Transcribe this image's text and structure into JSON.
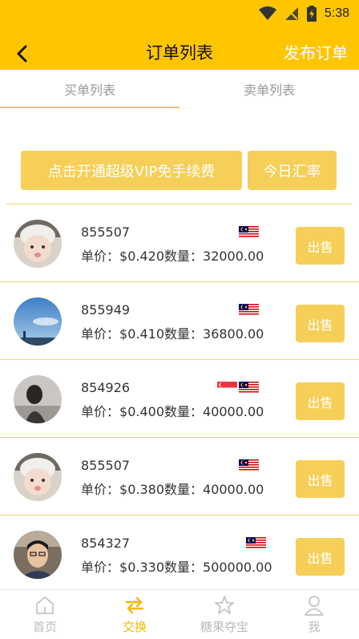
{
  "status_bar": {
    "time": "5:38"
  },
  "header": {
    "title": "订单列表",
    "action_label": "发布订单"
  },
  "tabs": [
    {
      "label": "买单列表"
    },
    {
      "label": "卖单列表"
    }
  ],
  "buttons": {
    "vip": "点击开通超级VIP免手续费",
    "rate": "今日汇率"
  },
  "orders": [
    {
      "id": "855507",
      "price_label": "单价：",
      "price": "$0.420",
      "qty_label": "数量：",
      "qty": "32000.00",
      "flags": [
        "malaysia"
      ],
      "sell_label": "出售",
      "avatar": "baby"
    },
    {
      "id": "855949",
      "price_label": "单价：",
      "price": "$0.410",
      "qty_label": "数量：",
      "qty": "36800.00",
      "flags": [
        "malaysia"
      ],
      "sell_label": "出售",
      "avatar": "sky"
    },
    {
      "id": "854926",
      "price_label": "单价：",
      "price": "$0.400",
      "qty_label": "数量：",
      "qty": "40000.00",
      "flags": [
        "singapore",
        "malaysia"
      ],
      "sell_label": "出售",
      "avatar": "woman"
    },
    {
      "id": "855507",
      "price_label": "单价：",
      "price": "$0.380",
      "qty_label": "数量：",
      "qty": "40000.00",
      "flags": [
        "malaysia"
      ],
      "sell_label": "出售",
      "avatar": "baby"
    },
    {
      "id": "854327",
      "price_label": "单价：",
      "price": "$0.330",
      "qty_label": "数量：",
      "qty": "500000.00",
      "flags": [
        "malaysia"
      ],
      "sell_label": "出售",
      "avatar": "man"
    }
  ],
  "bottom_nav": [
    {
      "label": "首页",
      "icon": "home-icon",
      "active": false
    },
    {
      "label": "交换",
      "icon": "exchange-icon",
      "active": true
    },
    {
      "label": "糖果夺宝",
      "icon": "star-icon",
      "active": false
    },
    {
      "label": "我",
      "icon": "person-icon",
      "active": false
    }
  ],
  "colors": {
    "brand": "#ffc600",
    "button": "#f5cf57",
    "active_nav": "#f5b800",
    "divider": "#f2d170"
  }
}
